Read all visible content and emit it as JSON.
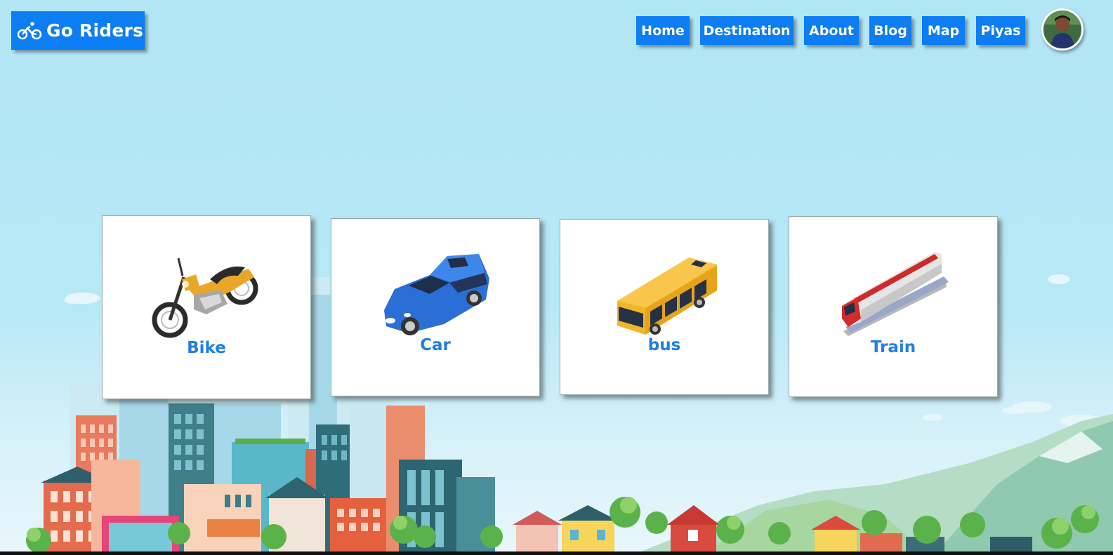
{
  "brand": {
    "name": "Go Riders",
    "icon": "bicycle-icon",
    "color": "#0d7df3"
  },
  "nav": {
    "items": [
      {
        "label": "Home"
      },
      {
        "label": "Destination"
      },
      {
        "label": "About"
      },
      {
        "label": "Blog"
      },
      {
        "label": "Map"
      },
      {
        "label": "Piyas"
      }
    ],
    "avatar": "user-avatar-photo"
  },
  "vehicles": [
    {
      "label": "Bike",
      "icon": "motorcycle-icon"
    },
    {
      "label": "Car",
      "icon": "car-icon"
    },
    {
      "label": "bus",
      "icon": "bus-icon"
    },
    {
      "label": "Train",
      "icon": "train-icon"
    }
  ],
  "colors": {
    "accent": "#0d7df3",
    "card_label": "#1f7fe5",
    "sky": "#b3e5f4"
  }
}
